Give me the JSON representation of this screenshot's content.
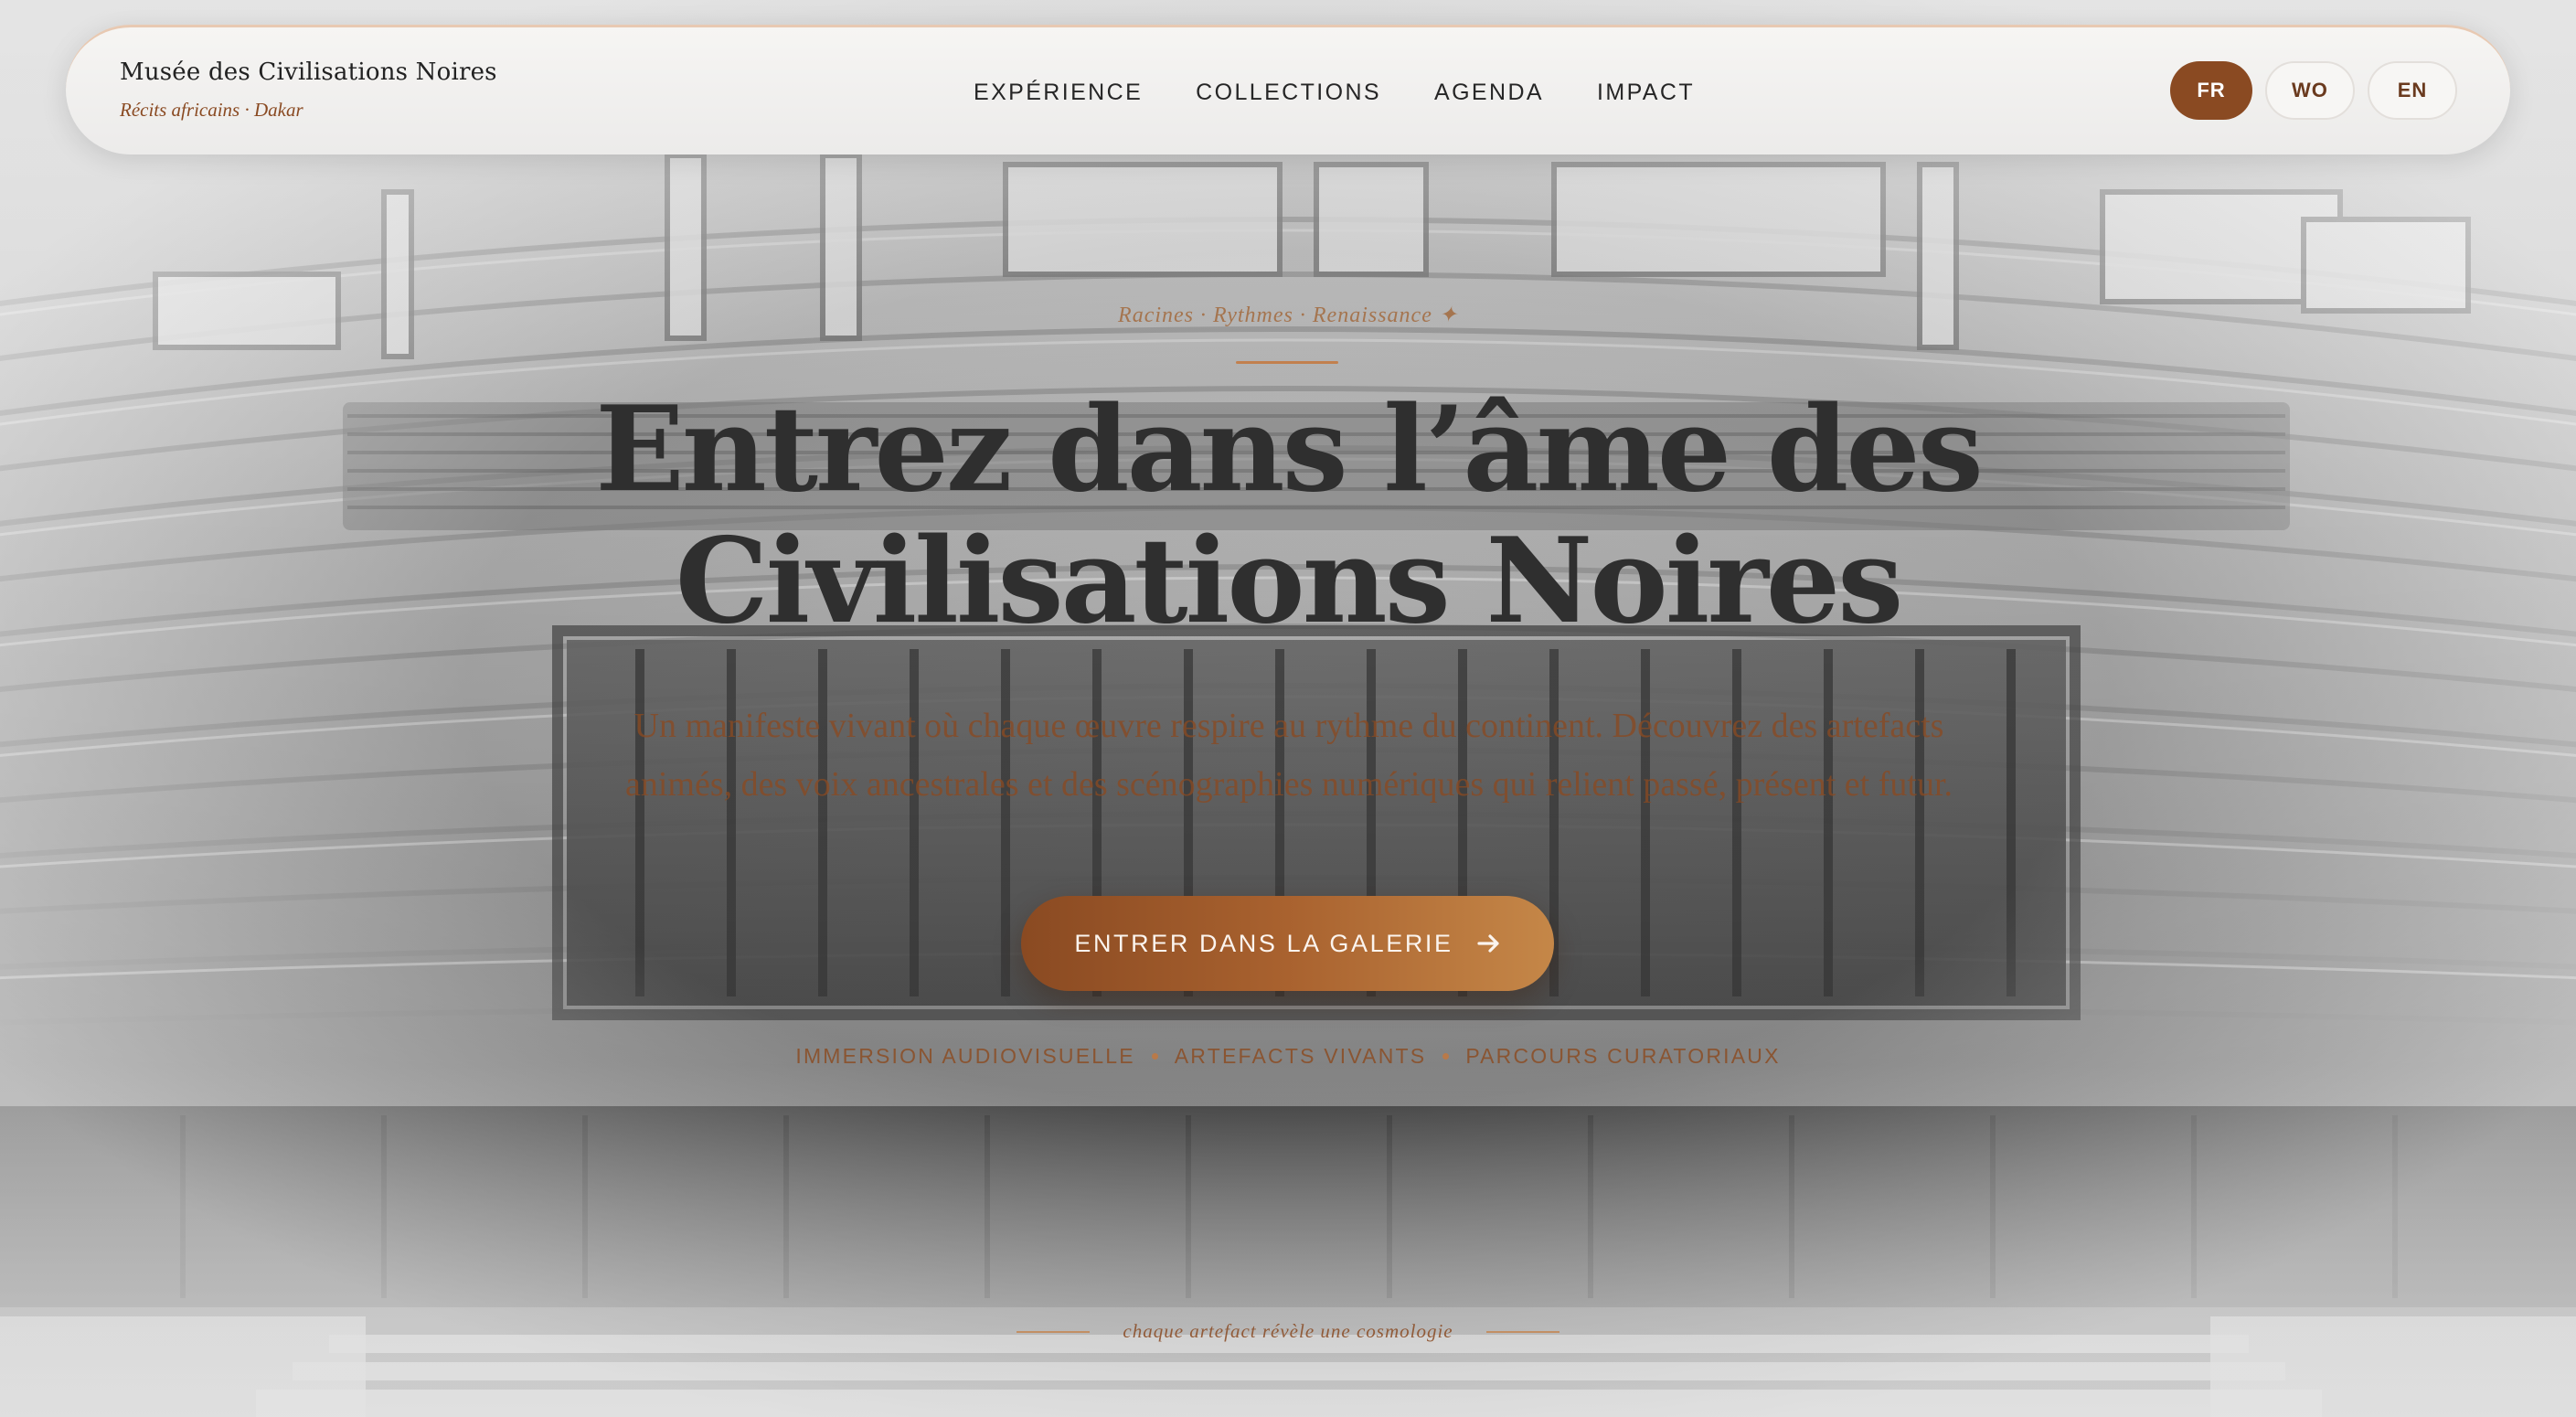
{
  "header": {
    "brand_title": "Musée des Civilisations Noires",
    "brand_subtitle": "Récits africains · Dakar",
    "nav": [
      {
        "label": "EXPÉRIENCE"
      },
      {
        "label": "COLLECTIONS"
      },
      {
        "label": "AGENDA"
      },
      {
        "label": "IMPACT"
      }
    ],
    "languages": [
      {
        "label": "FR",
        "active": true
      },
      {
        "label": "WO",
        "active": false
      },
      {
        "label": "EN",
        "active": false
      }
    ]
  },
  "hero": {
    "eyebrow": "Racines · Rythmes · Renaissance ✦",
    "headline_line1": "Entrez dans l’âme des",
    "headline_line2": "Civilisations Noires",
    "lead": "Un manifeste vivant où chaque œuvre respire au rythme du continent. Découvrez des artefacts animés, des voix ancestrales et des scénographies numériques qui relient passé, présent et futur.",
    "cta_label": "ENTRER DANS LA GALERIE",
    "cta_icon": "arrow-right-icon",
    "features": [
      {
        "label": "IMMERSION AUDIOVISUELLE"
      },
      {
        "label": "ARTEFACTS VIVANTS"
      },
      {
        "label": "PARCOURS CURATORIAUX"
      }
    ],
    "footer_note": "chaque artefact révèle une cosmologie"
  },
  "colors": {
    "accent": "#8a4a22",
    "accent_light": "#c58748",
    "headline": "#2f2f2f"
  }
}
